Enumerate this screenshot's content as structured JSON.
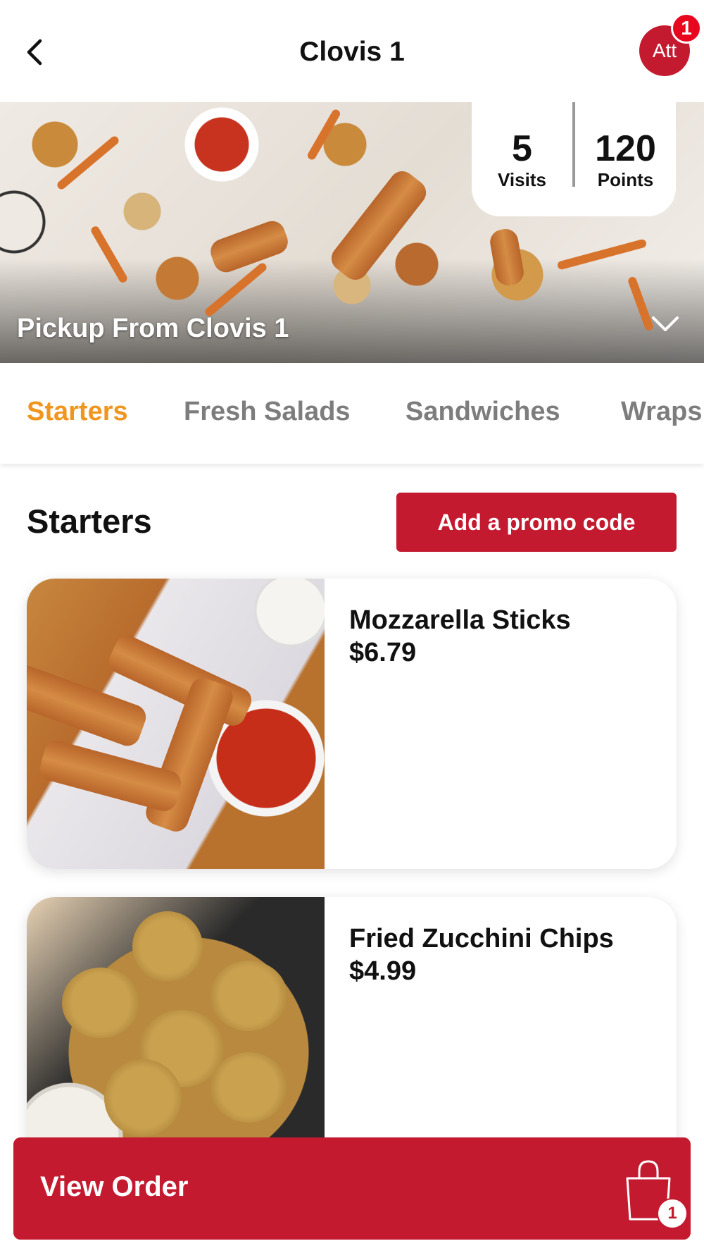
{
  "header": {
    "title": "Clovis 1",
    "avatar_initials": "Att",
    "notification_count": "1"
  },
  "hero": {
    "visits_value": "5",
    "visits_label": "Visits",
    "points_value": "120",
    "points_label": "Points",
    "pickup_text": "Pickup From Clovis 1"
  },
  "tabs": [
    {
      "label": "Starters",
      "active": true
    },
    {
      "label": "Fresh Salads",
      "active": false
    },
    {
      "label": "Sandwiches",
      "active": false
    },
    {
      "label": "Wraps",
      "active": false
    }
  ],
  "section": {
    "title": "Starters",
    "promo_label": "Add a promo code"
  },
  "items": [
    {
      "name": "Mozzarella Sticks",
      "price": "$6.79"
    },
    {
      "name": "Fried Zucchini Chips",
      "price": "$4.99"
    }
  ],
  "order_bar": {
    "label": "View Order",
    "cart_count": "1"
  },
  "colors": {
    "brand_red": "#c41a30",
    "active_tab": "#f0961e",
    "inactive_tab": "#7d7d7d"
  }
}
